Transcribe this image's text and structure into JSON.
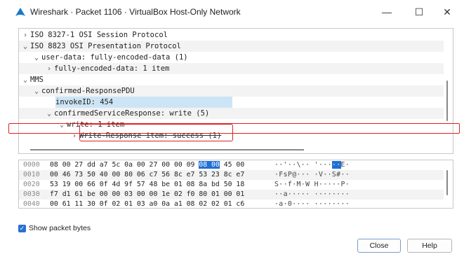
{
  "window": {
    "title": "Wireshark · Packet 1106 · VirtualBox Host-Only Network",
    "minimize_glyph": "—",
    "maximize_glyph": "☐",
    "close_glyph": "✕"
  },
  "tree": {
    "rows": [
      {
        "chevron": ">",
        "text": "ISO 8327-1 OSI Session Protocol"
      },
      {
        "chevron": "v",
        "text": "ISO 8823 OSI Presentation Protocol"
      },
      {
        "chevron": "v",
        "text": "user-data: fully-encoded-data (1)"
      },
      {
        "chevron": ">",
        "text": "fully-encoded-data: 1 item"
      },
      {
        "chevron": "v",
        "text": "MMS"
      },
      {
        "chevron": "v",
        "text": "confirmed-ResponsePDU"
      },
      {
        "chevron": "",
        "text": "invokeID: 454"
      },
      {
        "chevron": "v",
        "text": "confirmedServiceResponse: write (5)"
      },
      {
        "chevron": "v",
        "text": "write: 1 item"
      },
      {
        "chevron": ">",
        "text": "Write-Response item: success (1)"
      }
    ]
  },
  "hex": {
    "rows": [
      {
        "offset": "0000",
        "bytes_a": "08 00 27 dd a7 5c 0a 00  27 00 00 09 ",
        "bytes_sel": "08 00",
        "bytes_b": " 45 00",
        "ascii_a": "··'··\\·· '···",
        "ascii_sel": "··",
        "ascii_b": "E·"
      },
      {
        "offset": "0010",
        "bytes_a": "00 46 73 50 40 00 80 06  c7 56 8c e7 53 23 8c e7",
        "bytes_sel": "",
        "bytes_b": "",
        "ascii_a": "·FsP@··· ·V··S#··",
        "ascii_sel": "",
        "ascii_b": ""
      },
      {
        "offset": "0020",
        "bytes_a": "53 19 00 66 0f 4d 9f 57  48 be 01 08 8a bd 50 18",
        "bytes_sel": "",
        "bytes_b": "",
        "ascii_a": "S··f·M·W H·····P·",
        "ascii_sel": "",
        "ascii_b": ""
      },
      {
        "offset": "0030",
        "bytes_a": "f7 d1 61 be 00 00 03 00  00 1e 02 f0 80 01 00 01",
        "bytes_sel": "",
        "bytes_b": "",
        "ascii_a": "··a····· ········",
        "ascii_sel": "",
        "ascii_b": ""
      },
      {
        "offset": "0040",
        "bytes_a": "00 61 11 30 0f 02 01 03  a0 0a a1 08 02 02 01 c6",
        "bytes_sel": "",
        "bytes_b": "",
        "ascii_a": "·a·0···· ········",
        "ascii_sel": "",
        "ascii_b": ""
      }
    ]
  },
  "options": {
    "show_packet_bytes_label": "Show packet bytes",
    "show_packet_bytes_checked": true
  },
  "buttons": {
    "close_label": "Close",
    "help_label": "Help"
  },
  "colors": {
    "selection": "#1f6fd6",
    "highlight_row": "#cce5f6",
    "annotation_red": "#e02020"
  }
}
